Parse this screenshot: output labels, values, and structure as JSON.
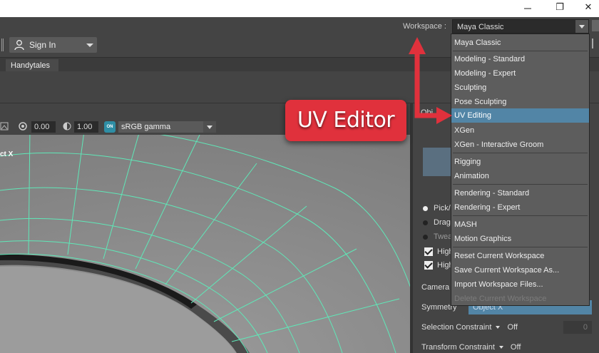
{
  "window": {
    "maximize_glyph": "❐",
    "close_glyph": "✕"
  },
  "workspace": {
    "label": "Workspace :",
    "selected": "Maya Classic"
  },
  "toolbar": {
    "sign_in_label": "Sign In"
  },
  "shelf": {
    "tab": "Handytales"
  },
  "viewport_toolbar": {
    "exposure": "0.00",
    "gamma": "1.00",
    "on_badge": "ON",
    "color_space": "sRGB gamma"
  },
  "viewport": {
    "label": "ct X"
  },
  "right_panel": {
    "obj_header": "Obj",
    "pick": "Pick/",
    "drag": "Drag",
    "tweak": "Twea",
    "high1": "High",
    "high2": "High",
    "camera": "Camera",
    "symmetry_label": "Symmetry",
    "symmetry_value": "Object X",
    "selection_constraint_label": "Selection Constraint",
    "selection_constraint_value": "Off",
    "selection_constraint_number": "0",
    "transform_constraint_label": "Transform Constraint",
    "transform_constraint_value": "Off"
  },
  "menu": {
    "items": [
      {
        "label": "Maya Classic"
      },
      {
        "label": "Modeling - Standard"
      },
      {
        "label": "Modeling - Expert"
      },
      {
        "label": "Sculpting"
      },
      {
        "label": "Pose Sculpting"
      },
      {
        "label": "UV Editing",
        "active": true
      },
      {
        "label": "XGen"
      },
      {
        "label": "XGen - Interactive Groom"
      },
      {
        "label": "Rigging"
      },
      {
        "label": "Animation"
      },
      {
        "label": "Rendering - Standard"
      },
      {
        "label": "Rendering - Expert"
      },
      {
        "label": "MASH"
      },
      {
        "label": "Motion Graphics"
      },
      {
        "label": "Reset Current Workspace"
      },
      {
        "label": "Save Current Workspace As..."
      },
      {
        "label": "Import Workspace Files..."
      },
      {
        "label": "Delete Current Workspace",
        "disabled": true
      }
    ]
  },
  "annotation": {
    "callout": "UV Editor",
    "color": "#e0313c"
  },
  "colors": {
    "accent": "#5285a6",
    "wireframe": "#5fe8b8",
    "panel": "#444444"
  }
}
